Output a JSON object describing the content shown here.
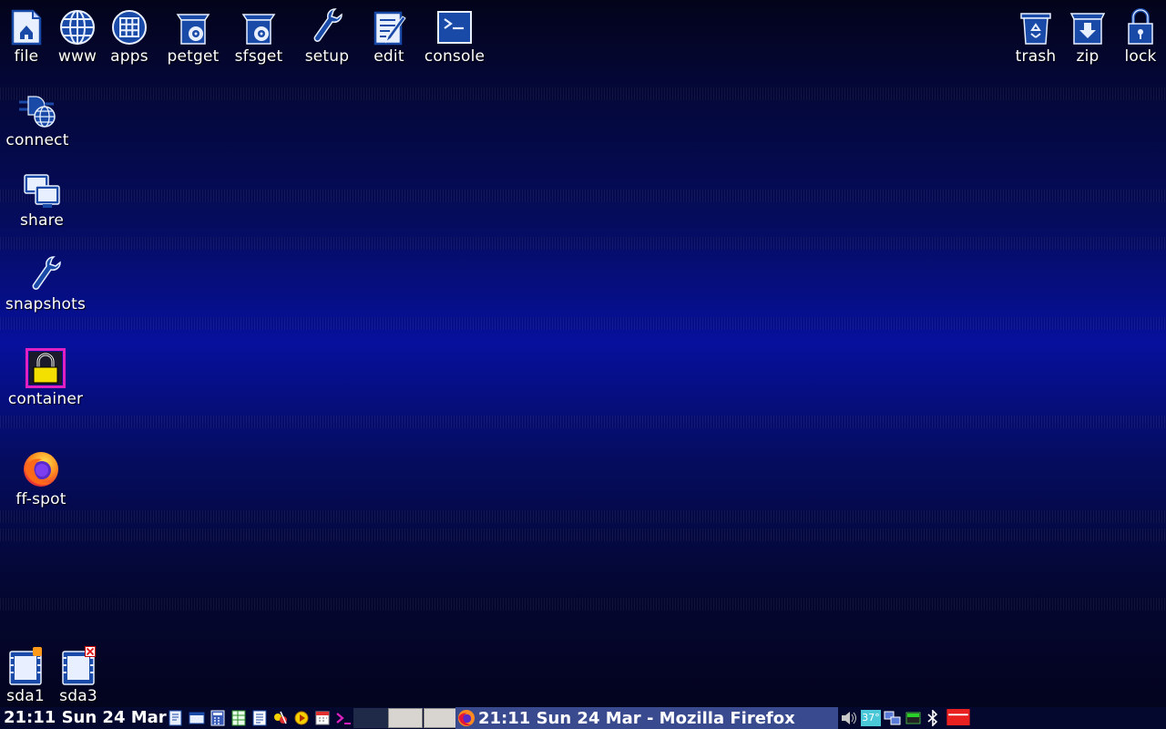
{
  "desktop": {
    "top_icons": [
      {
        "label": "file",
        "icon": "file-manager-icon"
      },
      {
        "label": "www",
        "icon": "globe-icon"
      },
      {
        "label": "apps",
        "icon": "apps-grid-icon"
      },
      {
        "label": "petget",
        "icon": "package-manager-icon"
      },
      {
        "label": "sfsget",
        "icon": "sfs-download-icon"
      },
      {
        "label": "setup",
        "icon": "wrench-icon"
      },
      {
        "label": "edit",
        "icon": "text-editor-icon"
      },
      {
        "label": "console",
        "icon": "terminal-icon"
      }
    ],
    "right_icons": [
      {
        "label": "trash",
        "icon": "trash-icon"
      },
      {
        "label": "zip",
        "icon": "zip-icon"
      },
      {
        "label": "lock",
        "icon": "lock-icon"
      }
    ],
    "left_icons": [
      {
        "label": "connect",
        "icon": "network-connect-icon"
      },
      {
        "label": "share",
        "icon": "share-icon"
      },
      {
        "label": "snapshots",
        "icon": "wrench-icon"
      },
      {
        "label": "container",
        "icon": "container-lock-icon"
      },
      {
        "label": "ff-spot",
        "icon": "firefox-icon"
      }
    ],
    "drives": [
      {
        "label": "sda1",
        "icon": "drive-icon",
        "status": "mounted"
      },
      {
        "label": "sda3",
        "icon": "drive-icon",
        "status": "unmounted"
      }
    ]
  },
  "taskbar": {
    "clock": "21:11 Sun 24 Mar",
    "active_task": "21:11 Sun 24 Mar - Mozilla Firefox",
    "temperature": "37°",
    "quicklaunch": [
      "show-desktop-icon",
      "window-icon",
      "calculator-icon",
      "spreadsheet-icon",
      "document-icon",
      "paint-icon",
      "media-player-icon",
      "calendar-icon",
      "terminal-icon"
    ],
    "tray": [
      "volume-icon",
      "temperature-icon",
      "network-icon",
      "battery-icon",
      "bluetooth-icon",
      "power-icon"
    ]
  },
  "colors": {
    "icon_blue": "#1a4aa8",
    "icon_light": "#e8f0ff",
    "taskbar_bg": "#05082e",
    "active_task_bg": "#3a4a8e",
    "container_pink": "#e020c0",
    "lock_yellow": "#f4e000"
  }
}
